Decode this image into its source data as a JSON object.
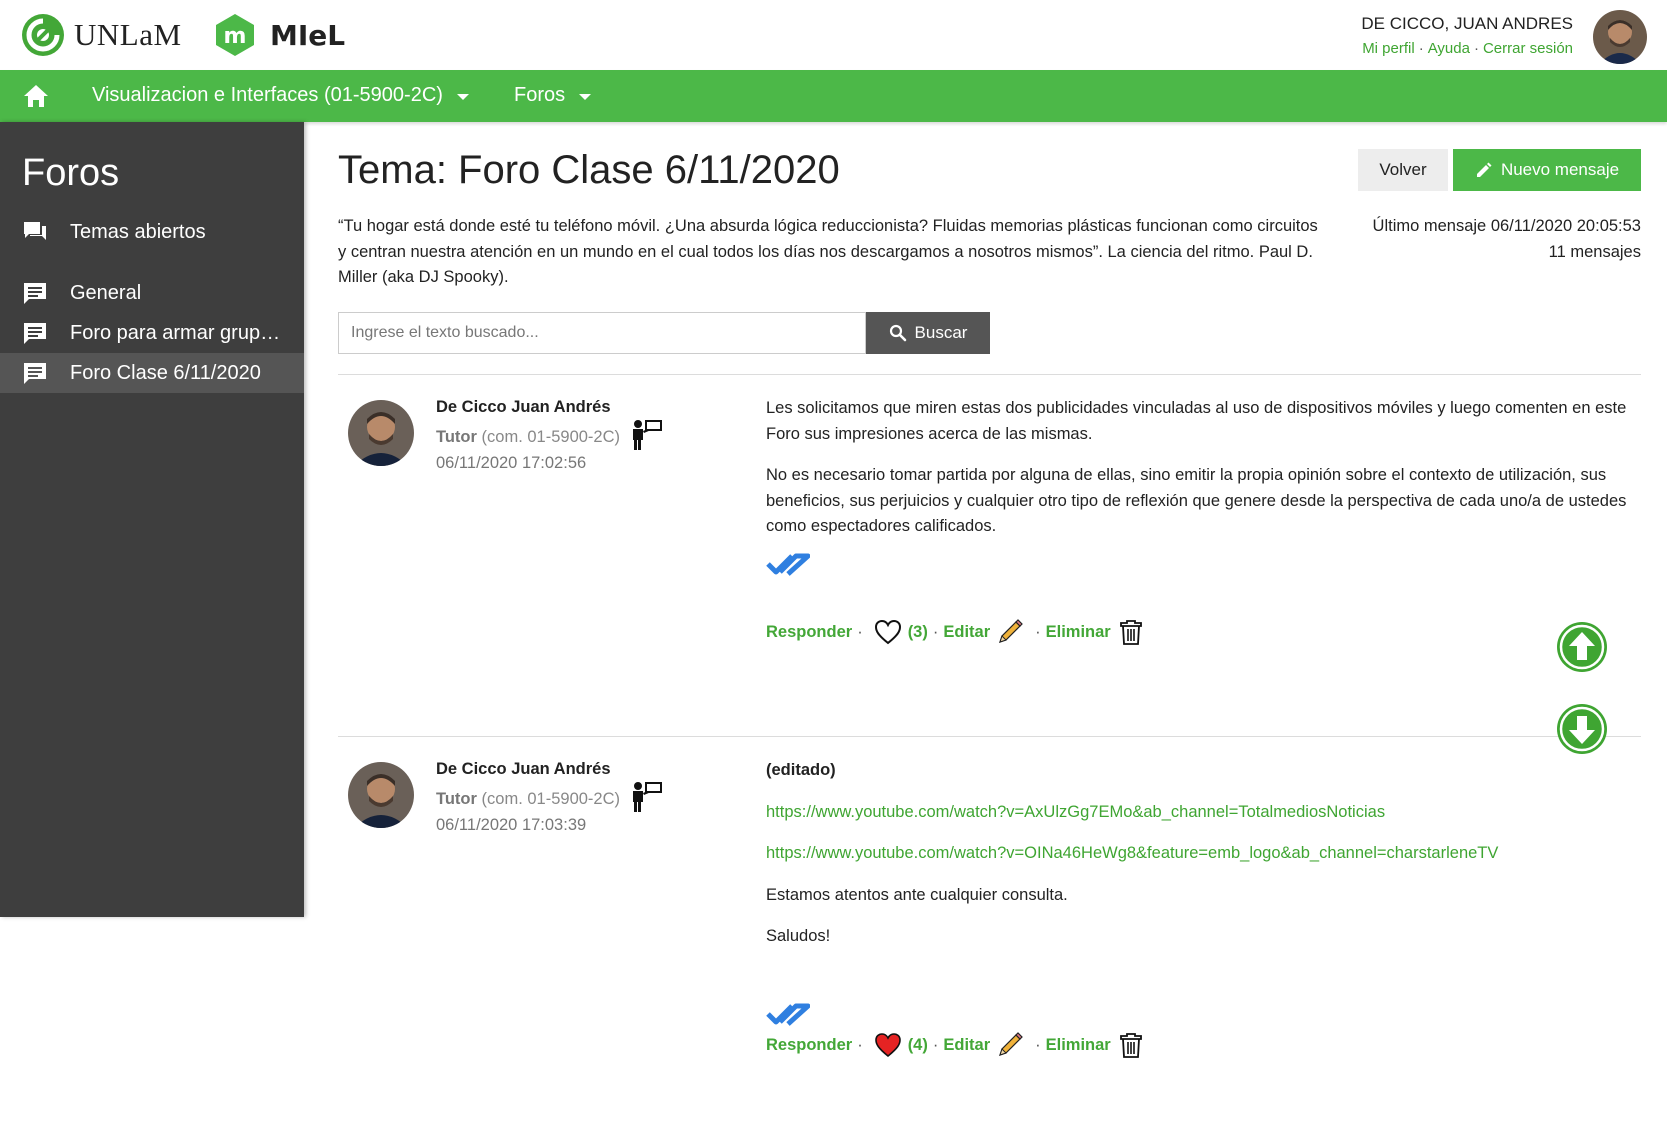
{
  "header": {
    "brand_unlam": "UNLaM",
    "brand_miel": "MIeL",
    "user_name": "DE CICCO, JUAN ANDRES",
    "links": [
      "Mi perfil",
      "Ayuda",
      "Cerrar sesión"
    ],
    "link_separator": "·"
  },
  "navbar": {
    "course": "Visualizacion e Interfaces (01-5900-2C)",
    "section": "Foros"
  },
  "sidebar": {
    "title": "Foros",
    "items": [
      {
        "label": "Temas abiertos",
        "icon": "forum-icon"
      },
      {
        "label": "General",
        "icon": "comment-icon"
      },
      {
        "label": "Foro para armar grupo...",
        "icon": "comment-icon"
      },
      {
        "label": "Foro Clase 6/11/2020",
        "icon": "comment-icon",
        "active": true
      }
    ]
  },
  "topic": {
    "title": "Tema: Foro Clase 6/11/2020",
    "description": "“Tu hogar está donde esté tu teléfono móvil. ¿Una absurda lógica reduccionista? Fluidas memorias plásticas funcionan como circuitos y centran nuestra atención en un mundo en el cual todos los días nos descargamos a nosotros mismos”. La ciencia del ritmo. Paul D. Miller (aka DJ Spooky).",
    "last_message": "Último mensaje 06/11/2020 20:05:53",
    "message_count": "11 mensajes",
    "back_button": "Volver",
    "new_message_button": "Nuevo mensaje"
  },
  "search": {
    "placeholder": "Ingrese el texto buscado...",
    "button": "Buscar"
  },
  "posts": [
    {
      "author": "De Cicco Juan Andrés",
      "role": "Tutor",
      "commission": "(com. 01-5900-2C)",
      "date": "06/11/2020 17:02:56",
      "paragraphs": [
        "Les solicitamos que miren estas dos publicidades vinculadas al uso de dispositivos móviles y luego comenten en este Foro sus impresiones acerca de las mismas.",
        "No es necesario tomar partida por alguna de ellas, sino emitir la propia opinión sobre el contexto de utilización, sus beneficios,  sus perjuicios y cualquier otro tipo de reflexión que genere desde la perspectiva de cada uno/a de ustedes como espectadores calificados."
      ],
      "reply": "Responder",
      "likes": "(3)",
      "liked": false,
      "edit": "Editar",
      "delete": "Eliminar"
    },
    {
      "author": "De Cicco Juan Andrés",
      "role": "Tutor",
      "commission": "(com. 01-5900-2C)",
      "date": "06/11/2020 17:03:39",
      "edited_label": "(editado)",
      "links": [
        "https://www.youtube.com/watch?v=AxUlzGg7EMo&ab_channel=TotalmediosNoticias",
        "https://www.youtube.com/watch?v=OINa46HeWg8&feature=emb_logo&ab_channel=charstarleneTV"
      ],
      "paragraphs": [
        "Estamos atentos ante cualquier consulta.",
        "Saludos!"
      ],
      "reply": "Responder",
      "likes": "(4)",
      "liked": true,
      "edit": "Editar",
      "delete": "Eliminar"
    }
  ],
  "colors": {
    "brand_green": "#4cb848",
    "link_green": "#3fa532",
    "sidebar": "#3e3e3e",
    "read_check": "#2f7fe0",
    "heart_liked": "#e52323"
  }
}
